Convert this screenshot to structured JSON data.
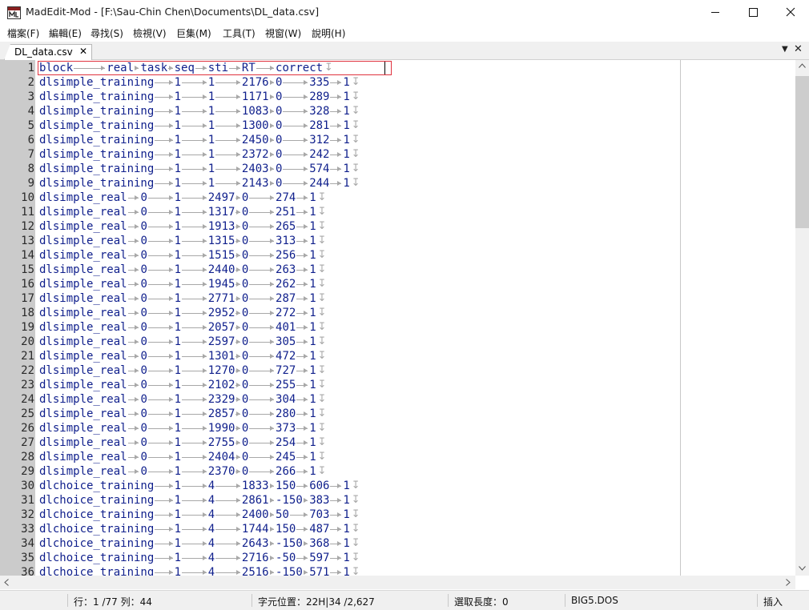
{
  "window": {
    "title": "MadEdit-Mod - [F:\\Sau-Chin Chen\\Documents\\DL_data.csv]"
  },
  "menu": [
    "檔案(F)",
    "編輯(E)",
    "尋找(S)",
    "檢視(V)",
    "巨集(M)",
    "工具(T)",
    "視窗(W)",
    "說明(H)"
  ],
  "tabs": {
    "active_label": "DL_data.csv",
    "close_glyph": "✕",
    "dropdown_glyph": "▼",
    "close_all_glyph": "✕"
  },
  "icons": {
    "app": "app-logo-icon",
    "minimize": "minimize-icon",
    "maximize": "maximize-icon",
    "close": "close-icon",
    "scroll_up": "scroll-up-arrow-icon",
    "scroll_down": "scroll-down-arrow-icon",
    "scroll_left": "scroll-left-arrow-icon",
    "scroll_right": "scroll-right-arrow-icon"
  },
  "colors": {
    "text": "#0f1f8c",
    "gutter": "#cbcbcb",
    "current_line_border": "#e0333f",
    "whitespace_marks": "#a8a8a8"
  },
  "editor": {
    "lines": [
      [
        "block",
        "real",
        "task",
        "seq",
        "sti",
        "RT",
        "correct"
      ],
      [
        "dlsimple_training",
        "1",
        "1",
        "2176",
        "0",
        "335",
        "1"
      ],
      [
        "dlsimple_training",
        "1",
        "1",
        "1171",
        "0",
        "289",
        "1"
      ],
      [
        "dlsimple_training",
        "1",
        "1",
        "1083",
        "0",
        "328",
        "1"
      ],
      [
        "dlsimple_training",
        "1",
        "1",
        "1300",
        "0",
        "281",
        "1"
      ],
      [
        "dlsimple_training",
        "1",
        "1",
        "2450",
        "0",
        "312",
        "1"
      ],
      [
        "dlsimple_training",
        "1",
        "1",
        "2372",
        "0",
        "242",
        "1"
      ],
      [
        "dlsimple_training",
        "1",
        "1",
        "2403",
        "0",
        "574",
        "1"
      ],
      [
        "dlsimple_training",
        "1",
        "1",
        "2143",
        "0",
        "244",
        "1"
      ],
      [
        "dlsimple_real",
        "0",
        "1",
        "2497",
        "0",
        "274",
        "1"
      ],
      [
        "dlsimple_real",
        "0",
        "1",
        "1317",
        "0",
        "251",
        "1"
      ],
      [
        "dlsimple_real",
        "0",
        "1",
        "1913",
        "0",
        "265",
        "1"
      ],
      [
        "dlsimple_real",
        "0",
        "1",
        "1315",
        "0",
        "313",
        "1"
      ],
      [
        "dlsimple_real",
        "0",
        "1",
        "1515",
        "0",
        "256",
        "1"
      ],
      [
        "dlsimple_real",
        "0",
        "1",
        "2440",
        "0",
        "263",
        "1"
      ],
      [
        "dlsimple_real",
        "0",
        "1",
        "1945",
        "0",
        "262",
        "1"
      ],
      [
        "dlsimple_real",
        "0",
        "1",
        "2771",
        "0",
        "287",
        "1"
      ],
      [
        "dlsimple_real",
        "0",
        "1",
        "2952",
        "0",
        "272",
        "1"
      ],
      [
        "dlsimple_real",
        "0",
        "1",
        "2057",
        "0",
        "401",
        "1"
      ],
      [
        "dlsimple_real",
        "0",
        "1",
        "2597",
        "0",
        "305",
        "1"
      ],
      [
        "dlsimple_real",
        "0",
        "1",
        "1301",
        "0",
        "472",
        "1"
      ],
      [
        "dlsimple_real",
        "0",
        "1",
        "1270",
        "0",
        "727",
        "1"
      ],
      [
        "dlsimple_real",
        "0",
        "1",
        "2102",
        "0",
        "255",
        "1"
      ],
      [
        "dlsimple_real",
        "0",
        "1",
        "2329",
        "0",
        "304",
        "1"
      ],
      [
        "dlsimple_real",
        "0",
        "1",
        "2857",
        "0",
        "280",
        "1"
      ],
      [
        "dlsimple_real",
        "0",
        "1",
        "1990",
        "0",
        "373",
        "1"
      ],
      [
        "dlsimple_real",
        "0",
        "1",
        "2755",
        "0",
        "254",
        "1"
      ],
      [
        "dlsimple_real",
        "0",
        "1",
        "2404",
        "0",
        "245",
        "1"
      ],
      [
        "dlsimple_real",
        "0",
        "1",
        "2370",
        "0",
        "266",
        "1"
      ],
      [
        "dlchoice_training",
        "1",
        "4",
        "1833",
        "150",
        "606",
        "1"
      ],
      [
        "dlchoice_training",
        "1",
        "4",
        "2861",
        "-150",
        "383",
        "1"
      ],
      [
        "dlchoice_training",
        "1",
        "4",
        "2400",
        "50",
        "703",
        "1"
      ],
      [
        "dlchoice_training",
        "1",
        "4",
        "1744",
        "150",
        "487",
        "1"
      ],
      [
        "dlchoice_training",
        "1",
        "4",
        "2643",
        "-150",
        "368",
        "1"
      ],
      [
        "dlchoice_training",
        "1",
        "4",
        "2716",
        "-50",
        "597",
        "1"
      ],
      [
        "dlchoice_training",
        "1",
        "4",
        "2516",
        "-150",
        "571",
        "1"
      ]
    ]
  },
  "status": {
    "position": "行：1 /77 列：44",
    "char_pos": "字元位置：22H|34 /2,627",
    "selection": "選取長度：0",
    "encoding": "BIG5.DOS",
    "mode": "插入"
  }
}
